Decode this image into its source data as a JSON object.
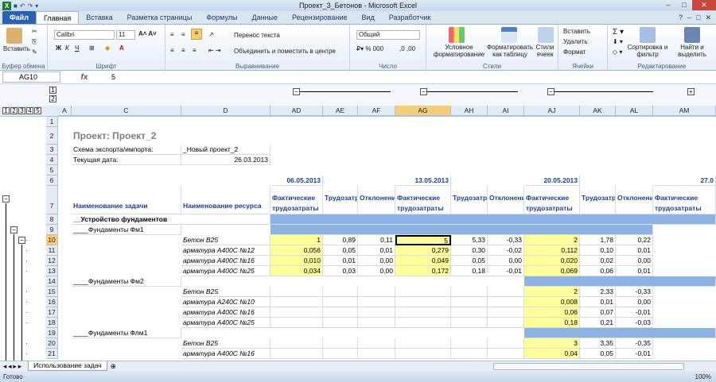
{
  "window": {
    "title": "Проект_3_Бетонов  -  Microsoft Excel",
    "logo": "X"
  },
  "tabs": {
    "file": "Файл",
    "items": [
      "Главная",
      "Вставка",
      "Разметка страницы",
      "Формулы",
      "Данные",
      "Рецензирование",
      "Вид",
      "Разработчик"
    ]
  },
  "ribbon": {
    "paste": "Вставить",
    "clipboard": "Буфер обмена",
    "font_name": "Calibri",
    "font_size": "11",
    "font_group": "Шрифт",
    "wrap_text": "Перенос текста",
    "merge_center": "Объединить и поместить в центре",
    "align_group": "Выравнивание",
    "number_format": "Общий",
    "number_group": "Число",
    "cond_format": "Условное форматирование",
    "format_table": "Форматировать как таблицу",
    "cell_styles": "Стили ячеек",
    "styles_group": "Стили",
    "insert": "Вставить",
    "delete": "Удалить",
    "format": "Формат",
    "cells_group": "Ячейки",
    "sort_filter": "Сортировка и фильтр",
    "find_select": "Найти и выделить",
    "edit_group": "Редактирование"
  },
  "formula": {
    "namebox": "AG10",
    "fx": "fx",
    "value": "5"
  },
  "outline_levels": [
    "1",
    "2",
    "3",
    "4",
    "5"
  ],
  "col_outline_levels": [
    "1",
    "2"
  ],
  "columns": [
    "A",
    "C",
    "D",
    "AD",
    "AE",
    "AF",
    "AG",
    "AH",
    "AI",
    "AJ",
    "AK",
    "AL",
    "AM"
  ],
  "rows": {
    "r2": "Проект: Проект_2",
    "r3_label": "Схема экспорта/импорта:",
    "r3_value": "_Новый проект_2",
    "r4_label": "Текущая дата:",
    "r4_value": "26.03.2013",
    "dates": [
      "06.05.2013",
      "13.05.2013",
      "20.05.2013",
      "27.0"
    ],
    "h_task": "Наименование задачи",
    "h_res": "Наименование ресурса",
    "h_fact": "Фактические трудозатраты",
    "h_labor": "Трудозатраты",
    "h_dev": "Отклонение",
    "r8": "__Устройство фундаментов",
    "r9": "____Фундаменты Фм1",
    "r14": "____Фундаменты Фм2",
    "r19": "____Фундаменты Флм1"
  },
  "grid_rows": [
    {
      "n": "10",
      "res": "Бетон В25",
      "v": [
        "1",
        "0,89",
        "0,11",
        "5",
        "5,33",
        "-0,33",
        "2",
        "1,78",
        "0,22"
      ]
    },
    {
      "n": "11",
      "res": "арматура А400С №12",
      "v": [
        "0,056",
        "0,05",
        "0,01",
        "0,279",
        "0,30",
        "-0,02",
        "0,112",
        "0,10",
        "0,01"
      ]
    },
    {
      "n": "12",
      "res": "арматура А400С №16",
      "v": [
        "0,010",
        "0,01",
        "0,00",
        "0,049",
        "0,05",
        "0,00",
        "0,020",
        "0,02",
        "0,00"
      ]
    },
    {
      "n": "13",
      "res": "арматура А400С №25",
      "v": [
        "0,034",
        "0,03",
        "0,00",
        "0,172",
        "0,18",
        "-0,01",
        "0,069",
        "0,06",
        "0,01"
      ]
    },
    {
      "n": "15",
      "res": "Бетон В25",
      "v": [
        "",
        "",
        "",
        "",
        "",
        "",
        "2",
        "2,33",
        "-0,33"
      ]
    },
    {
      "n": "16",
      "res": "арматура А240С №10",
      "v": [
        "",
        "",
        "",
        "",
        "",
        "",
        "0,008",
        "0,01",
        "0,00"
      ]
    },
    {
      "n": "17",
      "res": "арматура А400С №16",
      "v": [
        "",
        "",
        "",
        "",
        "",
        "",
        "0,06",
        "0,07",
        "-0,01"
      ]
    },
    {
      "n": "18",
      "res": "арматура А400С №25",
      "v": [
        "",
        "",
        "",
        "",
        "",
        "",
        "0,18",
        "0,21",
        "-0,03"
      ]
    },
    {
      "n": "20",
      "res": "Бетон В25",
      "v": [
        "",
        "",
        "",
        "",
        "",
        "",
        "3",
        "3,35",
        "-0,35"
      ]
    },
    {
      "n": "21",
      "res": "арматура А400С №16",
      "v": [
        "",
        "",
        "",
        "",
        "",
        "",
        "0,04",
        "0,05",
        "-0,01"
      ]
    }
  ],
  "sheet_tab": "Использование задач",
  "status": "Готово",
  "zoom": "100%"
}
